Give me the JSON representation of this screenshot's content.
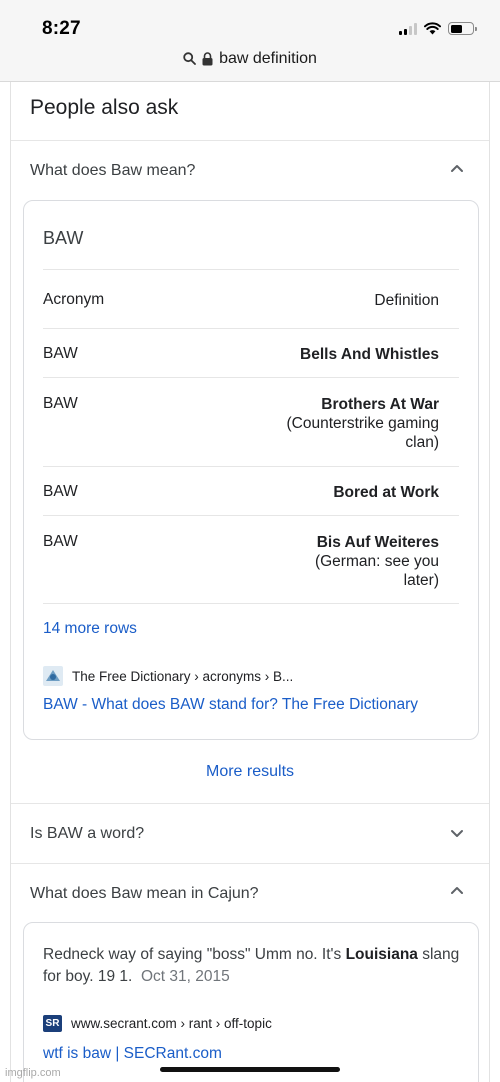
{
  "status_bar": {
    "time": "8:27",
    "icons": [
      "signal-icon",
      "wifi-icon",
      "battery-icon"
    ]
  },
  "address_bar": {
    "url": "baw definition",
    "icons": [
      "search-icon",
      "lock-icon"
    ]
  },
  "people_also_ask": {
    "title": "People also ask",
    "q1": {
      "question": "What does Baw mean?",
      "expanded": true,
      "answer": {
        "title": "BAW",
        "columns": [
          "Acronym",
          "Definition"
        ],
        "rows": [
          {
            "acronym": "BAW",
            "definition": "Bells And Whistles",
            "note": ""
          },
          {
            "acronym": "BAW",
            "definition": "Brothers At War",
            "note": "(Counterstrike gaming clan)"
          },
          {
            "acronym": "BAW",
            "definition": "Bored at Work",
            "note": ""
          },
          {
            "acronym": "BAW",
            "definition": "Bis Auf Weiteres",
            "note": "(German: see you later)"
          }
        ],
        "more_rows": "14 more rows",
        "source": "The Free Dictionary › acronyms › B...",
        "link": "BAW - What does BAW stand for? The Free Dictionary"
      }
    },
    "more_results": "More results",
    "q2": {
      "question": "Is BAW a word?",
      "expanded": false
    },
    "q3": {
      "question": "What does Baw mean in Cajun?",
      "expanded": true,
      "answer": {
        "text_before": "Redneck way of saying \"boss\" Umm no. It's ",
        "bold": "Louisiana",
        "text_after": " slang for boy. 19 1.",
        "date": "Oct 31, 2015",
        "source": "www.secrant.com › rant › off-topic",
        "source_logo": "SR",
        "link": "wtf is baw | SECRant.com"
      }
    }
  },
  "watermark": "imgflip.com",
  "colors": {
    "link": "#1a5dc8",
    "text": "#202124",
    "muted": "#70757a",
    "border": "#dadce0"
  }
}
